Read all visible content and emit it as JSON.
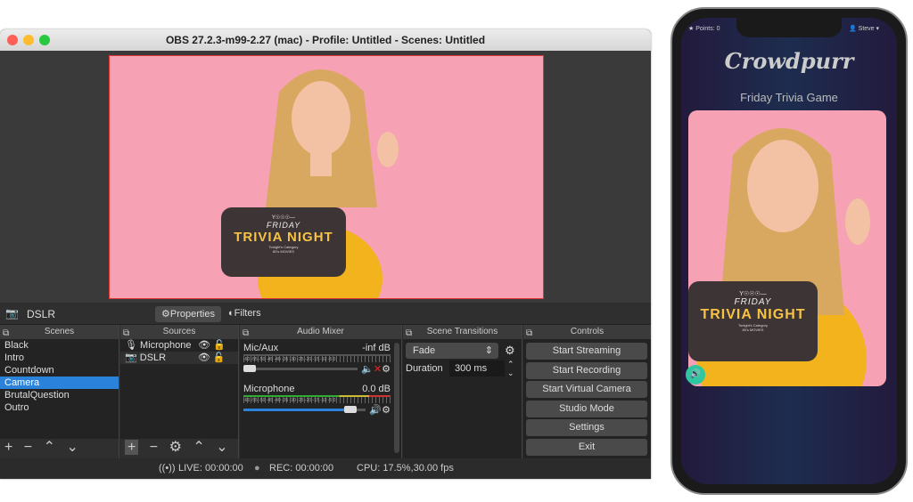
{
  "window": {
    "title": "OBS 27.2.3-m99-2.27 (mac) - Profile: Untitled - Scenes: Untitled"
  },
  "overlay": {
    "top": "Y☉☉☉—",
    "friday": "FRIDAY",
    "trivia": "TRIVIA NIGHT",
    "category_label": "Tonight's Category",
    "category": "80's MOVIES"
  },
  "source_bar": {
    "selected_source": "DSLR",
    "properties": "Properties",
    "filters": "Filters"
  },
  "scenes": {
    "title": "Scenes",
    "items": [
      "Black",
      "Intro",
      "Countdown",
      "Camera",
      "BrutalQuestion",
      "Outro"
    ],
    "selected": "Camera"
  },
  "sources": {
    "title": "Sources",
    "items": [
      "Microphone",
      "DSLR"
    ]
  },
  "audio": {
    "title": "Audio Mixer",
    "ticks": "-60 -55 -50 -45 -40 -35 -30 -25 -20 -15 -10 -5 0",
    "channels": [
      {
        "name": "Mic/Aux",
        "level": "-inf dB",
        "volume": 0.05,
        "muted": true
      },
      {
        "name": "Microphone",
        "level": "0.0 dB",
        "volume": 0.92,
        "muted": false
      }
    ]
  },
  "transitions": {
    "title": "Scene Transitions",
    "type": "Fade",
    "duration_label": "Duration",
    "duration": "300 ms"
  },
  "controls": {
    "title": "Controls",
    "buttons": [
      "Start Streaming",
      "Start Recording",
      "Start Virtual Camera",
      "Studio Mode",
      "Settings",
      "Exit"
    ]
  },
  "status": {
    "live": "LIVE: 00:00:00",
    "rec": "REC: 00:00:00",
    "cpu": "CPU: 17.5%,30.00 fps"
  },
  "phone": {
    "points": "Points: 0",
    "user": "Steve",
    "brand": "Crowdpurr",
    "game": "Friday Trivia Game"
  },
  "colors": {
    "accent": "#2a82da",
    "pink": "#f7a1b4",
    "sound_button": "#2fc7a0"
  }
}
